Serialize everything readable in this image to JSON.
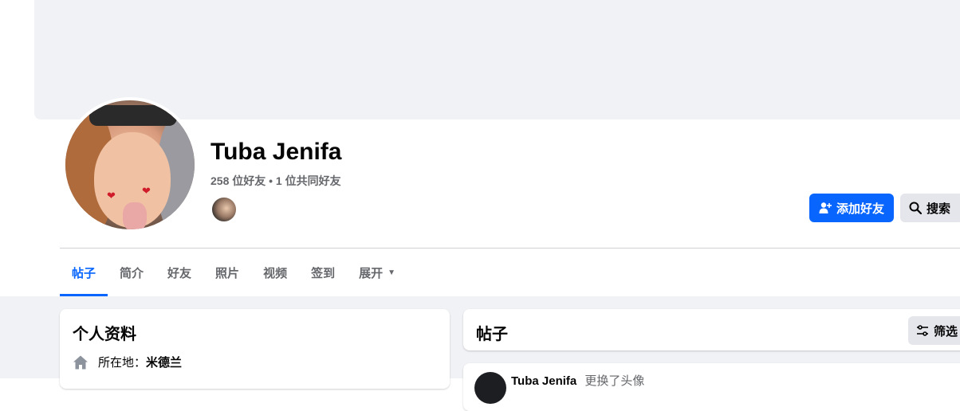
{
  "profile": {
    "name": "Tuba Jenifa",
    "friends_summary": "258 位好友 • 1 位共同好友"
  },
  "actions": {
    "add_friend_label": "添加好友",
    "search_label": "搜索"
  },
  "tabs": [
    {
      "label": "帖子",
      "active": true
    },
    {
      "label": "简介"
    },
    {
      "label": "好友"
    },
    {
      "label": "照片"
    },
    {
      "label": "视频"
    },
    {
      "label": "签到"
    },
    {
      "label": "展开"
    }
  ],
  "intro": {
    "title": "个人资料",
    "location_label": "所在地：",
    "location_value": "米德兰"
  },
  "posts": {
    "title": "帖子",
    "filter_label": "筛选",
    "first_post_author": "Tuba Jenifa",
    "first_post_action": "更换了头像"
  },
  "colors": {
    "accent": "#0866ff",
    "page_bg": "#f0f2f5",
    "secondary_text": "#65676b"
  }
}
